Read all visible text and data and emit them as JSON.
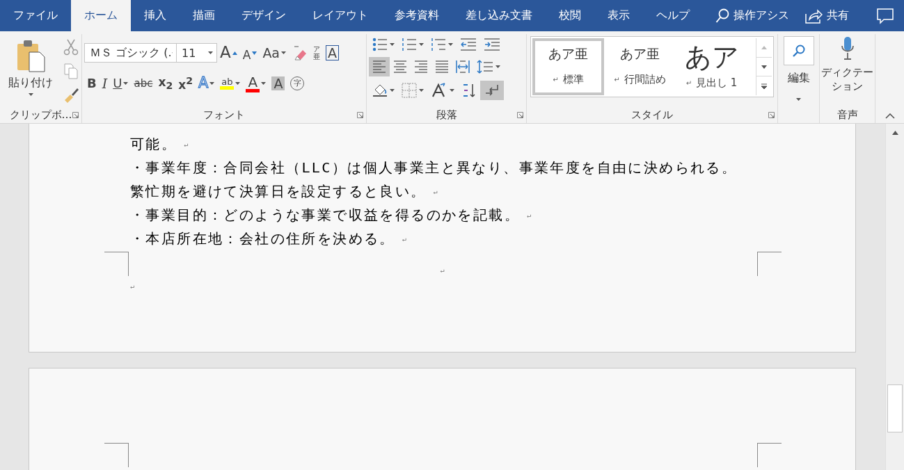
{
  "tabs": [
    {
      "label": "ファイル",
      "selected": false
    },
    {
      "label": "ホーム",
      "selected": true
    },
    {
      "label": "挿入",
      "selected": false
    },
    {
      "label": "描画",
      "selected": false
    },
    {
      "label": "デザイン",
      "selected": false
    },
    {
      "label": "レイアウト",
      "selected": false
    },
    {
      "label": "参考資料",
      "selected": false
    },
    {
      "label": "差し込み文書",
      "selected": false
    },
    {
      "label": "校閲",
      "selected": false
    },
    {
      "label": "表示",
      "selected": false
    },
    {
      "label": "ヘルプ",
      "selected": false
    }
  ],
  "tell_me": "操作アシス",
  "share": "共有",
  "clipboard": {
    "paste": "貼り付け",
    "label": "クリップボ…"
  },
  "font": {
    "name": "ＭＳ ゴシック (.",
    "size": "11",
    "row_1": [
      {
        "kind": "grow",
        "glyph": "A"
      },
      {
        "kind": "shrink",
        "glyph": "A"
      },
      {
        "kind": "case",
        "glyph": "Aa"
      },
      {
        "kind": "clear"
      },
      {
        "kind": "ruby",
        "glyph": "ア亜"
      },
      {
        "kind": "border",
        "glyph": "A"
      }
    ],
    "row_2": [
      {
        "kind": "bold",
        "glyph": "B"
      },
      {
        "kind": "italic",
        "glyph": "I"
      },
      {
        "kind": "underline",
        "glyph": "U"
      },
      {
        "kind": "strike",
        "glyph": "abc"
      },
      {
        "kind": "script",
        "glyph": "x$_{2}$"
      },
      {
        "kind": "script",
        "glyph": "x$^{2}$"
      },
      {
        "kind": "effects",
        "glyph": "A"
      },
      {
        "kind": "highlight",
        "glyph": "ab",
        "color": "#ffff00"
      },
      {
        "kind": "font_color",
        "glyph": "A",
        "color": "#ff0000"
      },
      {
        "kind": "shading",
        "glyph": "A"
      },
      {
        "kind": "enclose",
        "glyph": "字"
      }
    ],
    "label": "フォント"
  },
  "paragraph": {
    "alignment": [
      {
        "selected": true
      },
      {
        "selected": false
      },
      {
        "selected": false
      },
      {
        "selected": false
      },
      {
        "selected": false
      }
    ],
    "show_marks": {
      "on": true
    },
    "label": "段落"
  },
  "styles": {
    "items": [
      {
        "sample": "あア亜",
        "mark": "↵",
        "name": "標準",
        "kind": "body",
        "selected": true
      },
      {
        "sample": "あア亜",
        "mark": "↵",
        "name": "行間詰め",
        "kind": "body",
        "selected": false
      },
      {
        "sample": "あア",
        "mark": "↵",
        "name": "見出し 1",
        "kind": "heading",
        "selected": false
      }
    ],
    "label": "スタイル"
  },
  "editing": {
    "label": "編集"
  },
  "voice": {
    "button": "ディクテーション",
    "label": "音声"
  },
  "document": {
    "lines": [
      {
        "kind": "text",
        "text": "可能。",
        "mark": "↵"
      },
      {
        "kind": "text",
        "text": "・事業年度：合同会社（LLC）は個人事業主と異なり、事業年度を自由に決められる。"
      },
      {
        "kind": "text",
        "text": "繁忙期を避けて決算日を設定すると良い。",
        "mark": "↵"
      },
      {
        "kind": "text",
        "text": "・事業目的：どのような事業で収益を得るのかを記載。",
        "mark": "↵"
      },
      {
        "kind": "text",
        "text": "・本店所在地：会社の住所を決める。",
        "mark": "↵"
      },
      {
        "kind": "centered",
        "mark": "↵"
      },
      {
        "kind": "text",
        "mark": "↵"
      }
    ]
  }
}
